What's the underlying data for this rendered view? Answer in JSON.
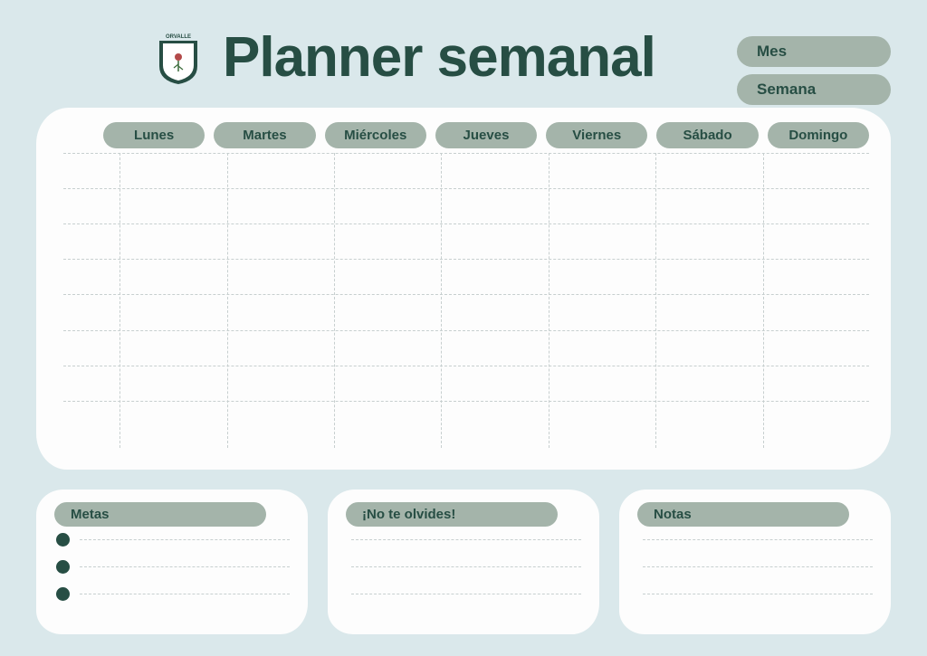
{
  "logo_text": "ORVALLE",
  "title": "Planner semanal",
  "top": {
    "mes": "Mes",
    "semana": "Semana"
  },
  "days": [
    "Lunes",
    "Martes",
    "Miércoles",
    "Jueves",
    "Viernes",
    "Sábado",
    "Domingo"
  ],
  "cards": {
    "metas": "Metas",
    "reminder": "¡No te olvides!",
    "notas": "Notas"
  }
}
